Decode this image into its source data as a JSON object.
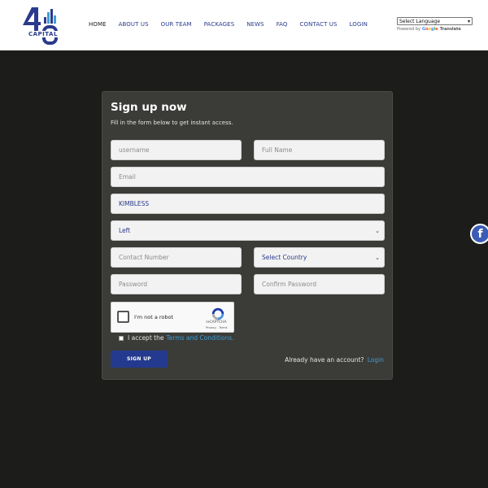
{
  "header": {
    "logo_text": "CAPITAL",
    "nav": [
      "HOME",
      "ABOUT US",
      "OUR TEAM",
      "PACKAGES",
      "NEWS",
      "FAQ",
      "CONTACT US",
      "LOGIN"
    ],
    "language_select": "Select Language",
    "powered_by": "Powered by",
    "google": "Google",
    "translate": "Translate"
  },
  "form": {
    "title": "Sign up now",
    "subtitle": "Fill in the form below to get instant access.",
    "username_placeholder": "username",
    "fullname_placeholder": "Full Name",
    "email_placeholder": "Email",
    "sponsor_value": "KIMBLESS",
    "position_value": "Left",
    "contact_placeholder": "Contact Number",
    "country_value": "Select Country",
    "password_placeholder": "Password",
    "confirm_placeholder": "Confirm Password",
    "recaptcha_label": "I'm not a robot",
    "recaptcha_brand": "reCAPTCHA",
    "recaptcha_links": "Privacy - Terms",
    "terms_text": "I accept the",
    "terms_link": "Terms and Conditions.",
    "signup_label": "SIGN UP",
    "already_text": "Already have an account?",
    "login_link": "Login"
  },
  "social": {
    "facebook_glyph": "f"
  },
  "colors": {
    "brand_blue": "#243a8e",
    "link_blue": "#3aa0d8",
    "page_bg": "#1c1c1a",
    "card_bg": "#3b3b38"
  }
}
